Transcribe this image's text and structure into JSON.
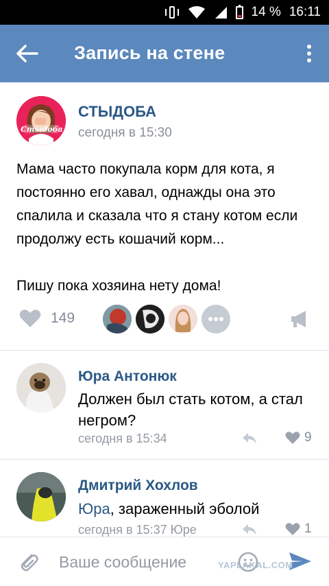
{
  "status_bar": {
    "battery": "14 %",
    "time": "16:11"
  },
  "app_bar": {
    "title": "Запись на стене",
    "color": "#5b88bd"
  },
  "post": {
    "author": "СТЫДОБА",
    "avatar_caption": "Стыдоба",
    "time": "сегодня в 15:30",
    "paragraphs": [
      "Мама часто покупала корм для кота, я постоянно его хавал, однажды она это спалила и сказала что я стану котом если продолжу есть кошачий корм...",
      "Пишу пока хозяина нету дома!"
    ],
    "likes_count": "149",
    "likers": [
      "liker-avatar-1",
      "liker-avatar-2",
      "liker-avatar-3"
    ]
  },
  "comments": [
    {
      "author": "Юра Антонюк",
      "text": "Должен был стать котом, а стал негром?",
      "time": "сегодня в 15:34",
      "likes": "9"
    },
    {
      "author": "Дмитрий Хохлов",
      "mention": "Юра",
      "text": ", зараженный эболой",
      "time": "сегодня в 15:37 Юре",
      "likes": "1"
    }
  ],
  "composer": {
    "placeholder": "Ваше сообщение"
  },
  "watermark": "YAPLAKAL.COM",
  "icons": {
    "back": "back-arrow-icon",
    "menu": "more-vertical-icon",
    "like": "heart-icon",
    "share": "megaphone-icon",
    "reply": "reply-arrow-icon",
    "attach": "paperclip-icon",
    "emoji": "smiley-icon",
    "send": "send-icon"
  }
}
